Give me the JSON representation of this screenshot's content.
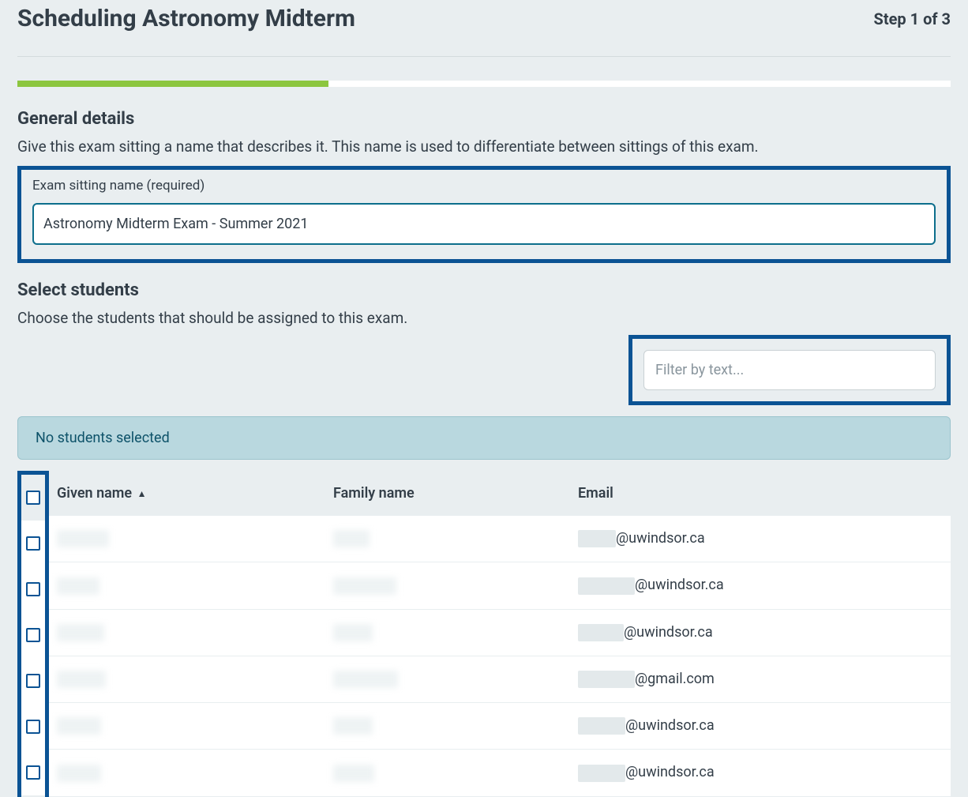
{
  "header": {
    "title": "Scheduling Astronomy Midterm",
    "step": "Step 1 of 3"
  },
  "progress": {
    "percent": 33.33
  },
  "general": {
    "title": "General details",
    "desc": "Give this exam sitting a name that describes it. This name is used to differentiate between sittings of this exam.",
    "field_label": "Exam sitting name (required)",
    "value": "Astronomy Midterm Exam - Summer 2021"
  },
  "students": {
    "title": "Select students",
    "desc": "Choose the students that should be assigned to this exam.",
    "filter_placeholder": "Filter by text...",
    "status": "No students selected",
    "columns": {
      "given": "Given name",
      "family": "Family name",
      "email": "Email"
    },
    "rows": [
      {
        "given_w": 66,
        "family_w": 46,
        "email_prefix_w": 48,
        "email_domain": "@uwindsor.ca"
      },
      {
        "given_w": 54,
        "family_w": 80,
        "email_prefix_w": 72,
        "email_domain": "@uwindsor.ca"
      },
      {
        "given_w": 60,
        "family_w": 50,
        "email_prefix_w": 58,
        "email_domain": "@uwindsor.ca"
      },
      {
        "given_w": 62,
        "family_w": 82,
        "email_prefix_w": 72,
        "email_domain": "@gmail.com"
      },
      {
        "given_w": 56,
        "family_w": 50,
        "email_prefix_w": 60,
        "email_domain": "@uwindsor.ca"
      },
      {
        "given_w": 56,
        "family_w": 52,
        "email_prefix_w": 60,
        "email_domain": "@uwindsor.ca"
      }
    ]
  }
}
